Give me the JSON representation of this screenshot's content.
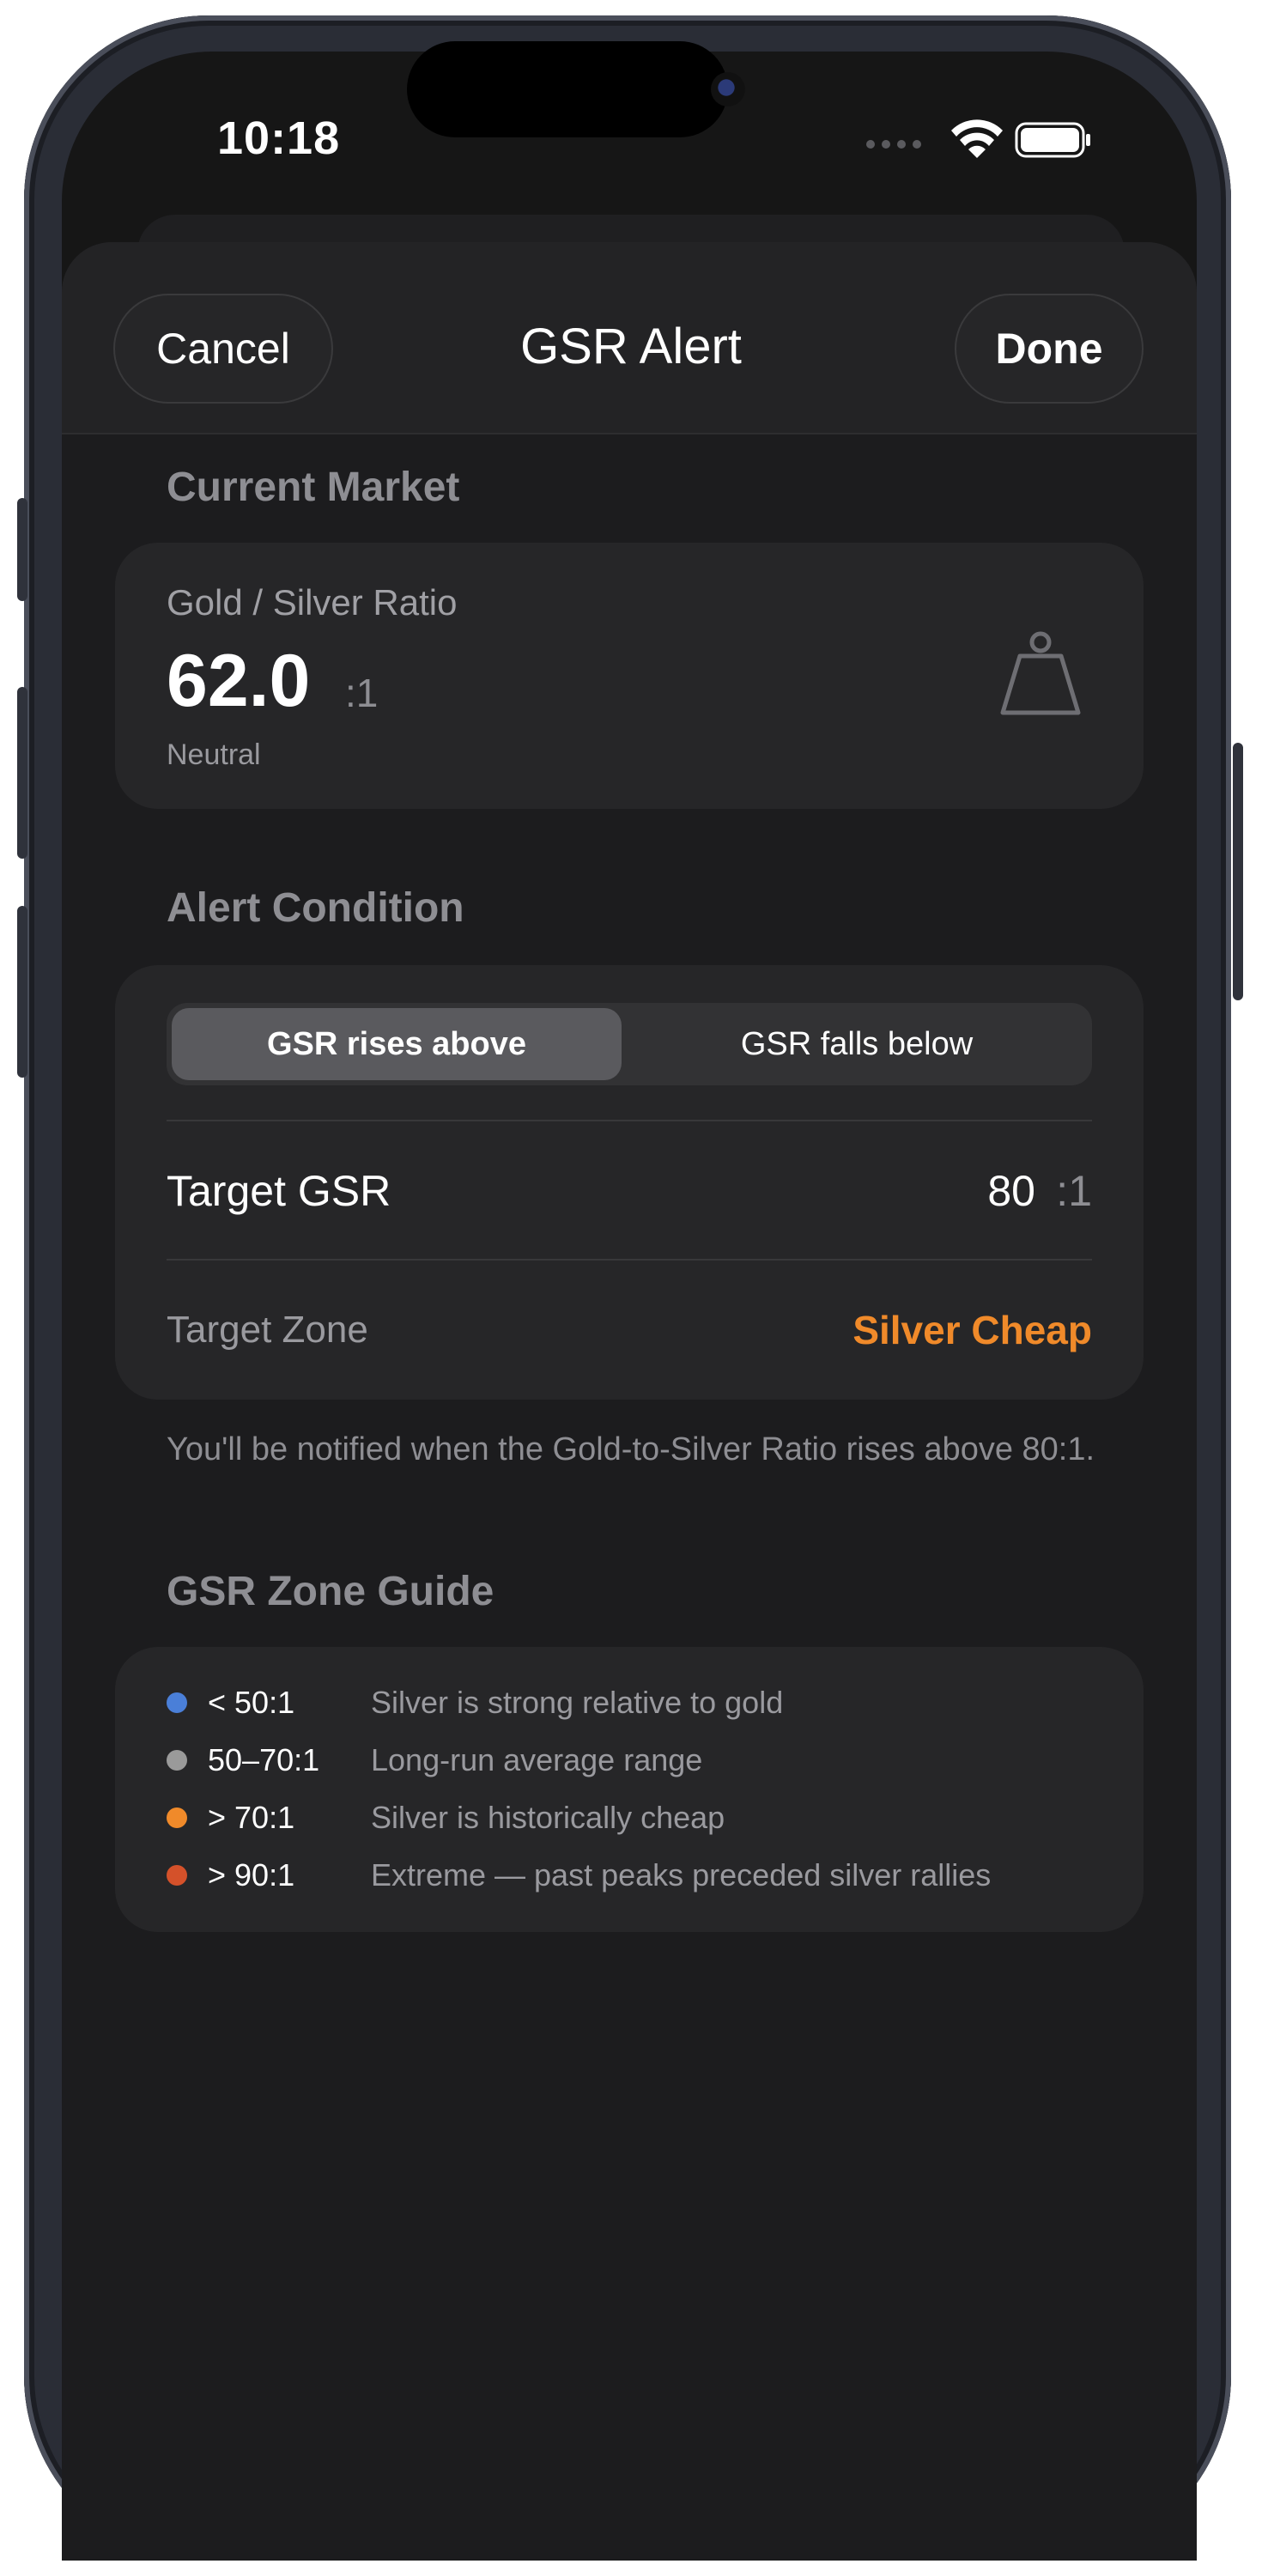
{
  "status_bar": {
    "time": "10:18"
  },
  "header": {
    "cancel_label": "Cancel",
    "title": "GSR Alert",
    "done_label": "Done"
  },
  "current_market": {
    "section_title": "Current Market",
    "ratio_label": "Gold / Silver Ratio",
    "ratio_value": "62.0",
    "ratio_suffix": ":1",
    "status": "Neutral",
    "icon": "weight-icon"
  },
  "alert_condition": {
    "section_title": "Alert Condition",
    "options": [
      "GSR rises above",
      "GSR falls below"
    ],
    "selected_option": "GSR rises above",
    "target_label": "Target GSR",
    "target_value": "80",
    "target_suffix": ":1",
    "zone_label": "Target Zone",
    "zone_value": "Silver Cheap",
    "zone_color": "#f08a2a",
    "note": "You'll be notified when the Gold-to-Silver Ratio rises above 80:1."
  },
  "zone_guide": {
    "section_title": "GSR Zone Guide",
    "items": [
      {
        "range": "< 50:1",
        "description": "Silver is strong relative to gold",
        "color": "#4a7fd8"
      },
      {
        "range": "50–70:1",
        "description": "Long-run average range",
        "color": "#9a9a9a"
      },
      {
        "range": "> 70:1",
        "description": "Silver is historically cheap",
        "color": "#f08a2a"
      },
      {
        "range": "> 90:1",
        "description": "Extreme — past peaks preceded silver rallies",
        "color": "#d4512a"
      }
    ]
  }
}
